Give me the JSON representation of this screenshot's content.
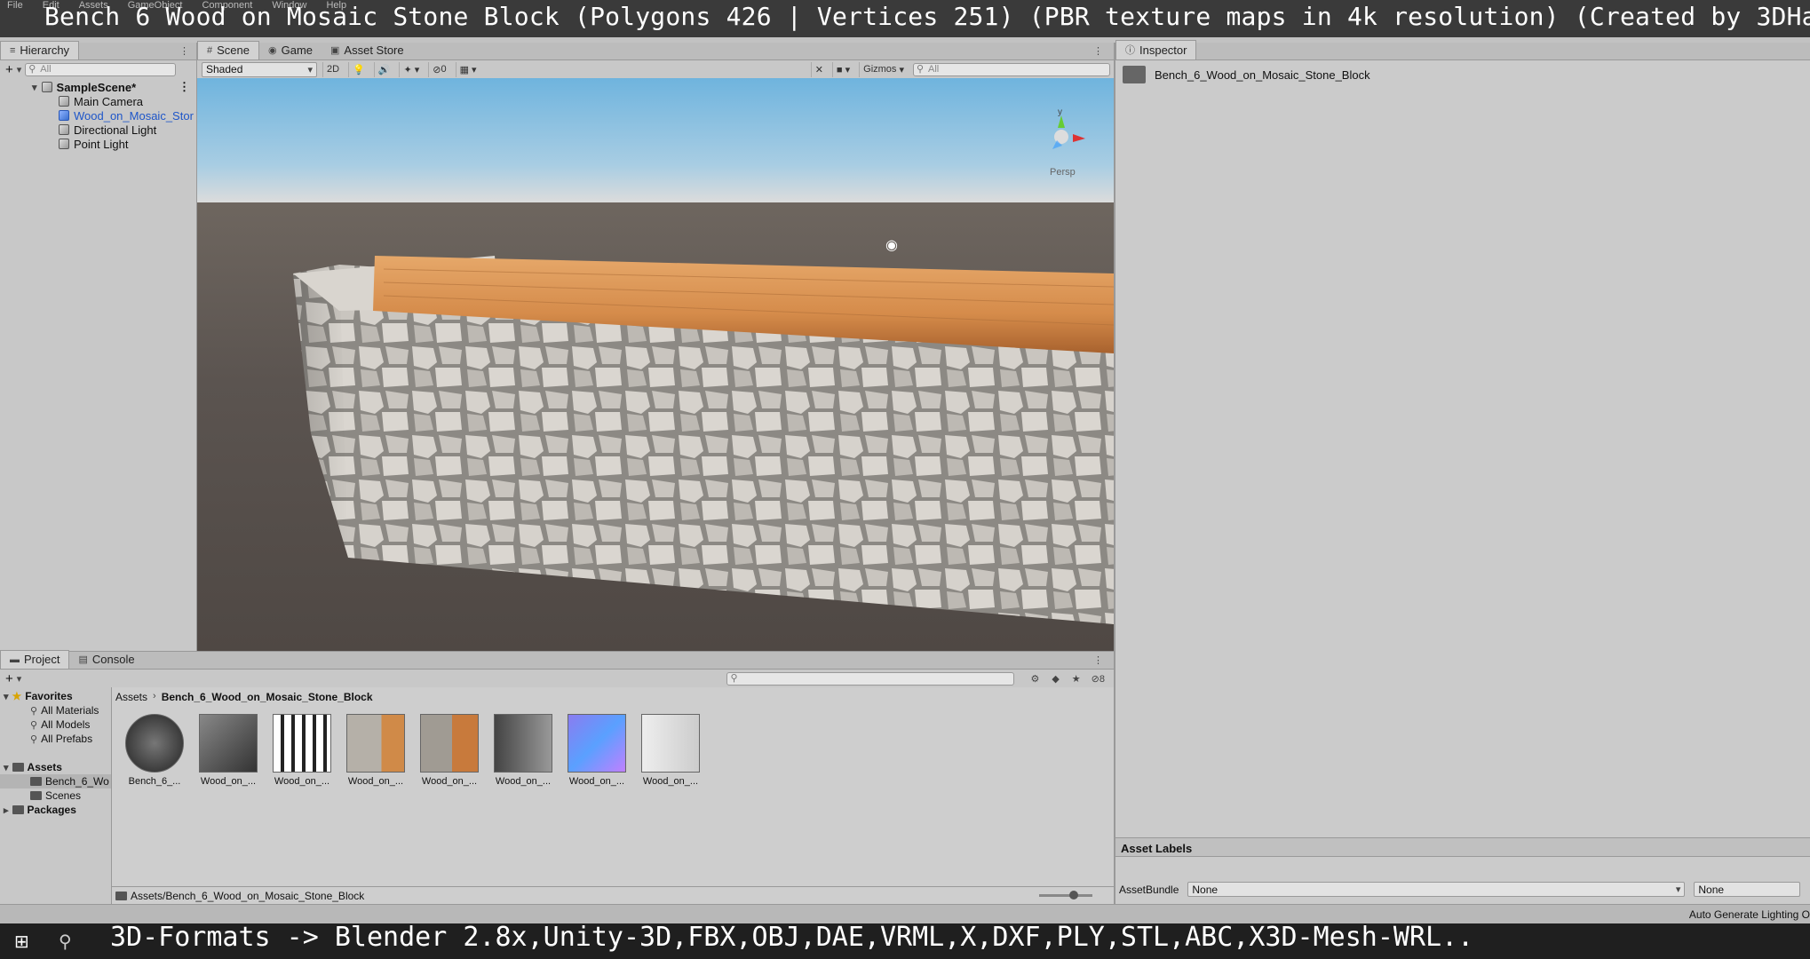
{
  "overlay": {
    "title": "Bench 6 Wood on Mosaic Stone Block (Polygons 426 | Vertices 251) (PBR texture maps in 4k resolution) (Created by 3DHaupt)",
    "bottom": "3D-Formats -> Blender 2.8x,Unity-3D,FBX,OBJ,DAE,VRML,X,DXF,PLY,STL,ABC,X3D-Mesh-WRL.."
  },
  "menu": [
    "File",
    "Edit",
    "Assets",
    "GameObject",
    "Component",
    "Window",
    "Help"
  ],
  "hierarchy": {
    "tab_label": "Hierarchy",
    "search_placeholder": "All",
    "scene_name": "SampleScene*",
    "items": [
      "Main Camera",
      "Wood_on_Mosaic_Stor",
      "Directional Light",
      "Point Light"
    ]
  },
  "scene": {
    "tabs": [
      "Scene",
      "Game",
      "Asset Store"
    ],
    "shading_mode": "Shaded",
    "mode_2d": "2D",
    "hidden_count": "0",
    "gizmos_label": "Gizmos",
    "search_placeholder": "All",
    "persp_label": "Persp",
    "gizmo_axis": "y"
  },
  "project": {
    "tabs": [
      "Project",
      "Console"
    ],
    "hidden_count": "8",
    "favorites_label": "Favorites",
    "favorites": [
      "All Materials",
      "All Models",
      "All Prefabs"
    ],
    "assets_label": "Assets",
    "asset_folders": [
      "Bench_6_Wo",
      "Scenes"
    ],
    "packages_label": "Packages",
    "breadcrumb_root": "Assets",
    "breadcrumb_current": "Bench_6_Wood_on_Mosaic_Stone_Block",
    "assets": [
      {
        "label": "Bench_6_..."
      },
      {
        "label": "Wood_on_..."
      },
      {
        "label": "Wood_on_..."
      },
      {
        "label": "Wood_on_..."
      },
      {
        "label": "Wood_on_..."
      },
      {
        "label": "Wood_on_..."
      },
      {
        "label": "Wood_on_..."
      },
      {
        "label": "Wood_on_..."
      }
    ],
    "path": "Assets/Bench_6_Wood_on_Mosaic_Stone_Block"
  },
  "inspector": {
    "tab_label": "Inspector",
    "object_name": "Bench_6_Wood_on_Mosaic_Stone_Block",
    "asset_labels_title": "Asset Labels",
    "assetbundle_label": "AssetBundle",
    "assetbundle_value": "None",
    "variant_value": "None"
  },
  "status": {
    "right_text": "Auto Generate Lighting O"
  }
}
